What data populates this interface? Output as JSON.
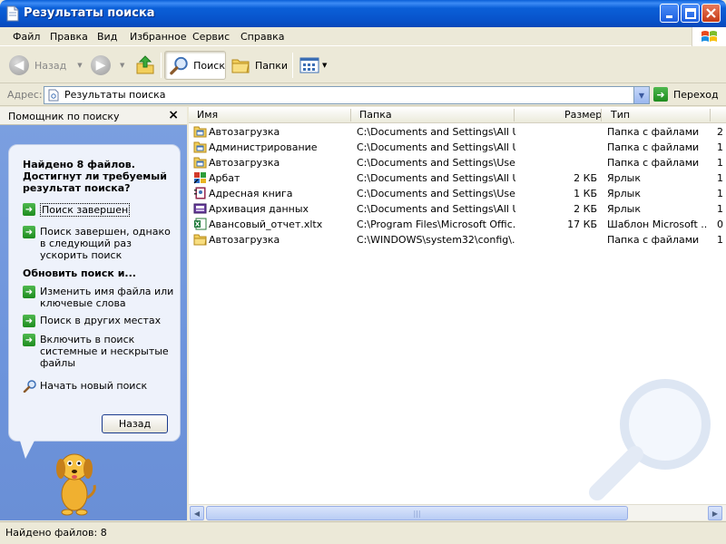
{
  "window": {
    "title": "Результаты поиска"
  },
  "menu": [
    {
      "label": "Файл"
    },
    {
      "label": "Правка"
    },
    {
      "label": "Вид"
    },
    {
      "label": "Избранное"
    },
    {
      "label": "Сервис"
    },
    {
      "label": "Справка"
    }
  ],
  "toolbar": {
    "back": "Назад",
    "search": "Поиск",
    "folders": "Папки"
  },
  "address": {
    "label": "Адрес:",
    "value": "Результаты поиска",
    "go": "Переход"
  },
  "assistant": {
    "title": "Помощник по поиску",
    "heading": "Найдено 8 файлов. Достигнут ли требуемый результат поиска?",
    "link_done": "Поиск завершен",
    "link_done_faster": "Поиск завершен, однако в следующий раз ускорить поиск",
    "refine_heading": "Обновить поиск и...",
    "link_change_name": "Изменить имя файла или ключевые слова",
    "link_other_places": "Поиск в других местах",
    "link_include_hidden": "Включить в поиск системные и нескрытые файлы",
    "link_new_search": "Начать новый поиск",
    "back_button": "Назад"
  },
  "columns": {
    "name": "Имя",
    "path": "Папка",
    "size": "Размер",
    "type": "Тип"
  },
  "files": [
    {
      "name": "Автозагрузка",
      "path": "C:\\Documents and Settings\\All U...",
      "size": "",
      "type": "Папка с файлами",
      "extra": "2",
      "icon": "folder-programs-icon"
    },
    {
      "name": "Администрирование",
      "path": "C:\\Documents and Settings\\All U...",
      "size": "",
      "type": "Папка с файлами",
      "extra": "1",
      "icon": "folder-programs-icon"
    },
    {
      "name": "Автозагрузка",
      "path": "C:\\Documents and Settings\\Use...",
      "size": "",
      "type": "Папка с файлами",
      "extra": "1",
      "icon": "folder-programs-icon"
    },
    {
      "name": "Арбат",
      "path": "C:\\Documents and Settings\\All U...",
      "size": "2 КБ",
      "type": "Ярлык",
      "extra": "1",
      "icon": "app-shortcut-icon"
    },
    {
      "name": "Адресная книга",
      "path": "C:\\Documents and Settings\\Use...",
      "size": "1 КБ",
      "type": "Ярлык",
      "extra": "1",
      "icon": "address-book-icon"
    },
    {
      "name": "Архивация данных",
      "path": "C:\\Documents and Settings\\All U...",
      "size": "2 КБ",
      "type": "Ярлык",
      "extra": "1",
      "icon": "backup-icon"
    },
    {
      "name": "Авансовый_отчет.xltx",
      "path": "C:\\Program Files\\Microsoft Offic...",
      "size": "17 КБ",
      "type": "Шаблон Microsoft ...",
      "extra": "0",
      "icon": "excel-template-icon"
    },
    {
      "name": "Автозагрузка",
      "path": "C:\\WINDOWS\\system32\\config\\...",
      "size": "",
      "type": "Папка с файлами",
      "extra": "1",
      "icon": "folder-icon"
    }
  ],
  "status": {
    "text": "Найдено файлов: 8"
  },
  "colors": {
    "title_bar": "#0a5fd8",
    "assistant_pane": "#7ca0e0",
    "go_green": "#1e8c1e"
  }
}
